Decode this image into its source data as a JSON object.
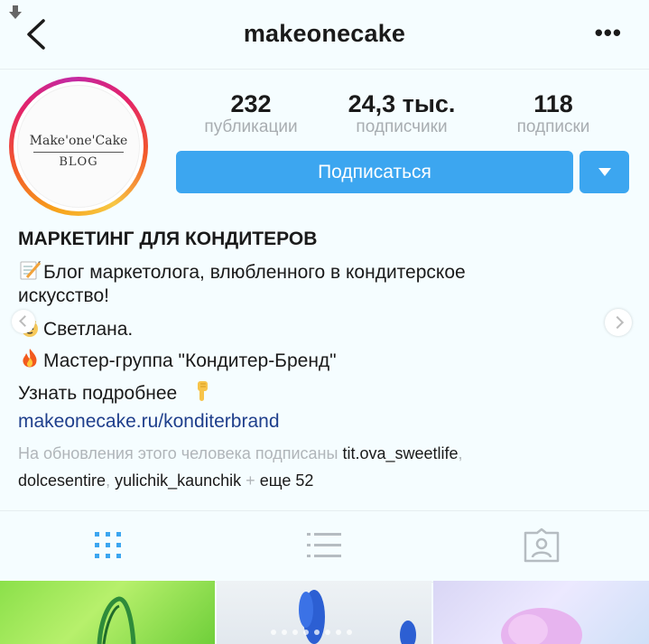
{
  "header": {
    "username": "makeonecake",
    "more_label": "•••"
  },
  "avatar": {
    "line1": "Make'one'Cake",
    "line2": "BLOG"
  },
  "stats": [
    {
      "value": "232",
      "label": "публикации"
    },
    {
      "value": "24,3 тыс.",
      "label": "подписчики"
    },
    {
      "value": "118",
      "label": "подписки"
    }
  ],
  "actions": {
    "follow_label": "Подписаться"
  },
  "bio": {
    "name": "МАРКЕТИНГ ДЛЯ КОНДИТЕРОВ",
    "line1": "Блог маркетолога, влюбленного в кондитерское",
    "line1b": "искусство!",
    "line2": "Светлана.",
    "line3": "Мастер-группа \"Кондитер-Бренд\"",
    "line4": "Узнать подробнее",
    "link": "makeonecake.ru/konditerbrand"
  },
  "followed_by": {
    "prefix": "На обновления этого человека подписаны",
    "user1": "tit.ova_sweetlife",
    "user2": "dolcesentire",
    "user3": "yulichik_kaunchik",
    "plus": "+",
    "more": "еще 52"
  },
  "tabs": [
    {
      "icon": "grid-icon",
      "active": true
    },
    {
      "icon": "list-icon",
      "active": false
    },
    {
      "icon": "tagged-photos-icon",
      "active": false
    }
  ],
  "colors": {
    "accent": "#3ca6f0",
    "link": "#1f3f8c",
    "muted": "#a8adb1",
    "active_tab": "#3ca6f0",
    "inactive_tab": "#b5bcc1"
  }
}
